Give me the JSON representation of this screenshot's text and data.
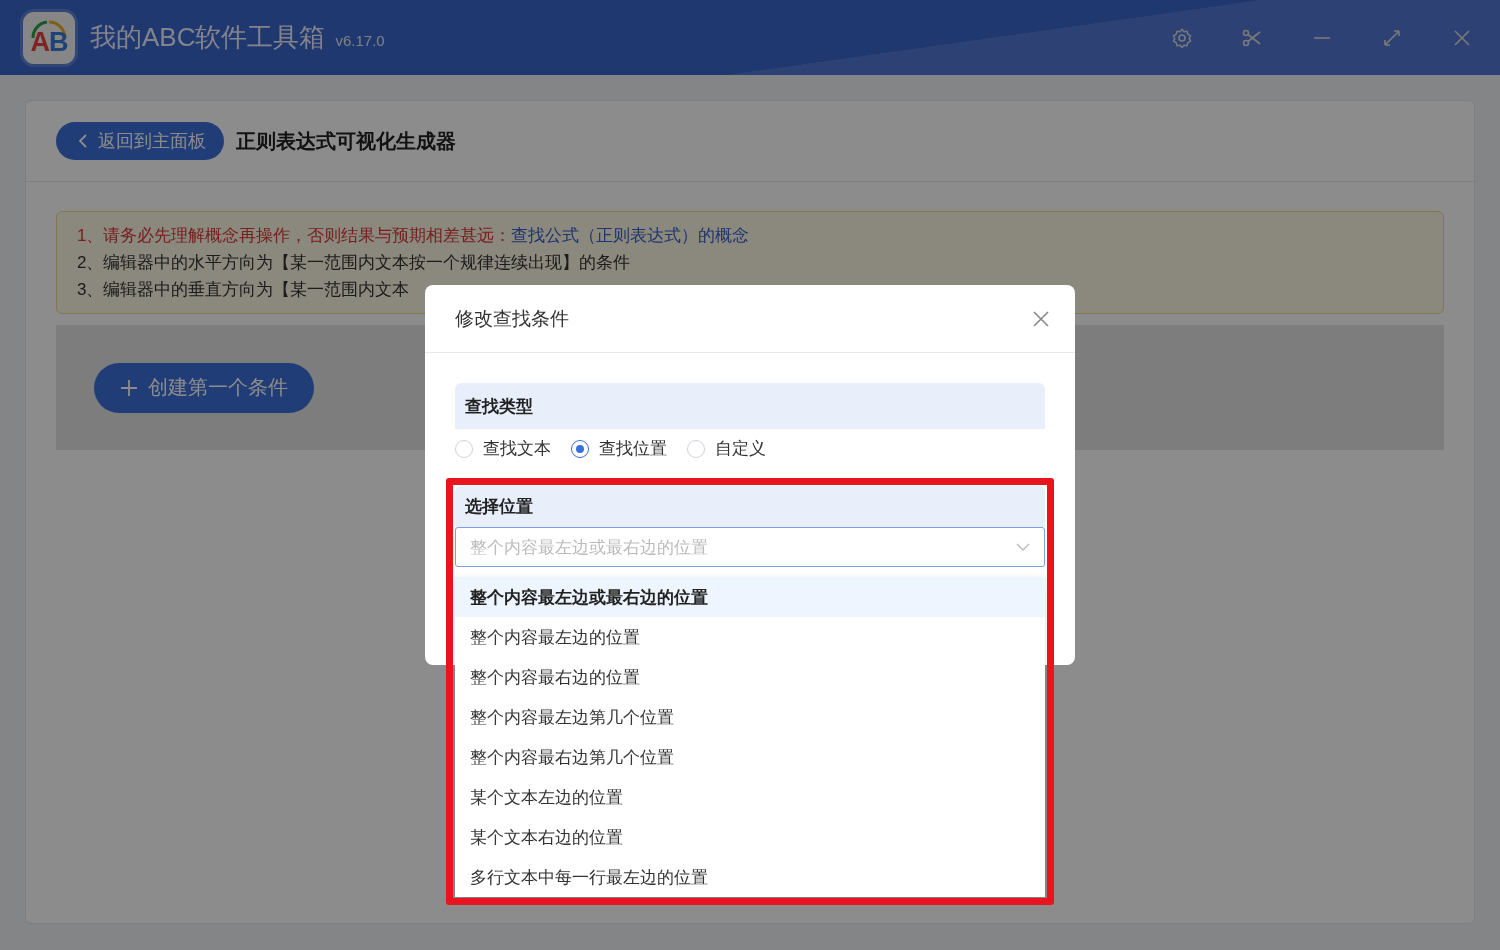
{
  "app": {
    "logo_text": "AB",
    "title": "我的ABC软件工具箱",
    "version": "v6.17.0"
  },
  "page": {
    "back_button": "返回到主面板",
    "title": "正则表达式可视化生成器",
    "notes": [
      {
        "kind": "warning",
        "text": "1、请务必先理解概念再操作，否则结果与预期相差甚远：",
        "link": "查找公式（正则表达式）的概念"
      },
      {
        "kind": "plain",
        "text": "2、编辑器中的水平方向为【某一范围内文本按一个规律连续出现】的条件"
      },
      {
        "kind": "plain",
        "text": "3、编辑器中的垂直方向为【某一范围内文本"
      }
    ],
    "create_button": "创建第一个条件"
  },
  "dialog": {
    "title": "修改查找条件",
    "sections": [
      {
        "kind": "radios",
        "label": "查找类型",
        "highlighted": false,
        "options": [
          {
            "label": "查找文本",
            "selected": false
          },
          {
            "label": "查找位置",
            "selected": true
          },
          {
            "label": "自定义",
            "selected": false
          }
        ]
      },
      {
        "kind": "select",
        "label": "选择位置",
        "highlighted": true,
        "select": {
          "placeholder": "整个内容最左边或最右边的位置",
          "expanded": true,
          "options": [
            {
              "label": "整个内容最左边或最右边的位置",
              "selected": true
            },
            {
              "label": "整个内容最左边的位置",
              "selected": false
            },
            {
              "label": "整个内容最右边的位置",
              "selected": false
            },
            {
              "label": "整个内容最左边第几个位置",
              "selected": false
            },
            {
              "label": "整个内容最右边第几个位置",
              "selected": false
            },
            {
              "label": "某个文本左边的位置",
              "selected": false
            },
            {
              "label": "某个文本右边的位置",
              "selected": false
            },
            {
              "label": "多行文本中每一行最左边的位置",
              "selected": false
            }
          ]
        }
      }
    ]
  }
}
